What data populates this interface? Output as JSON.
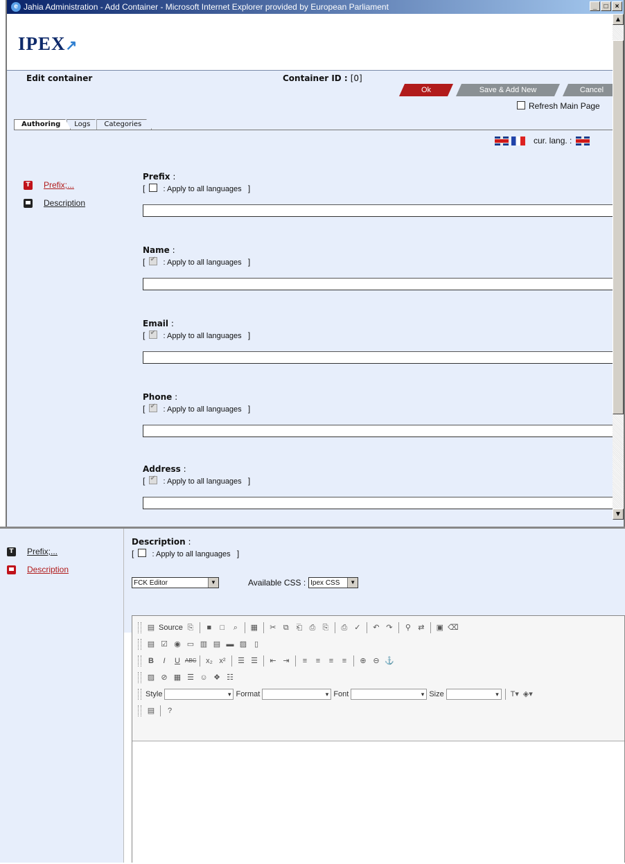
{
  "window": {
    "title": "Jahia Administration - Add Container - Microsoft Internet Explorer provided by European Parliament",
    "buttons": [
      "_",
      "□",
      "×"
    ]
  },
  "header": {
    "logo_text": "IPEX",
    "edit_title": "Edit container",
    "container_id_label": "Container ID :",
    "container_id_value": "[0]"
  },
  "actions": {
    "ok_label": "Ok",
    "save_add_label": "Save & Add New",
    "cancel_label": "Cancel",
    "refresh_label": "Refresh Main Page"
  },
  "tabs": [
    {
      "label": "Authoring"
    },
    {
      "label": "Logs"
    },
    {
      "label": "Categories"
    }
  ],
  "language": {
    "cur_lang_label": "cur. lang. :"
  },
  "nav": [
    {
      "label": "Prefix;..."
    },
    {
      "label": "Description"
    }
  ],
  "apply_text": ": Apply to all languages",
  "fields": [
    {
      "label": "Prefix",
      "colon": " :",
      "apply_checked": false
    },
    {
      "label": "Name",
      "colon": " :",
      "apply_checked": true
    },
    {
      "label": "Email",
      "colon": " :",
      "apply_checked": true
    },
    {
      "label": "Phone",
      "colon": " :",
      "apply_checked": true
    },
    {
      "label": "Address",
      "colon": " :",
      "apply_checked": true
    }
  ],
  "description": {
    "label": "Description",
    "colon": " :",
    "editor_select": "FCK Editor",
    "css_label": "Available CSS :",
    "css_select": "Ipex CSS"
  },
  "editor_toolbar": {
    "source_label": "Source",
    "style_label": "Style",
    "format_label": "Format",
    "font_label": "Font",
    "size_label": "Size"
  },
  "colors": {
    "panel_bg": "#e7eefb",
    "ok_red": "#b11b1b",
    "button_gray": "#8a9094"
  }
}
